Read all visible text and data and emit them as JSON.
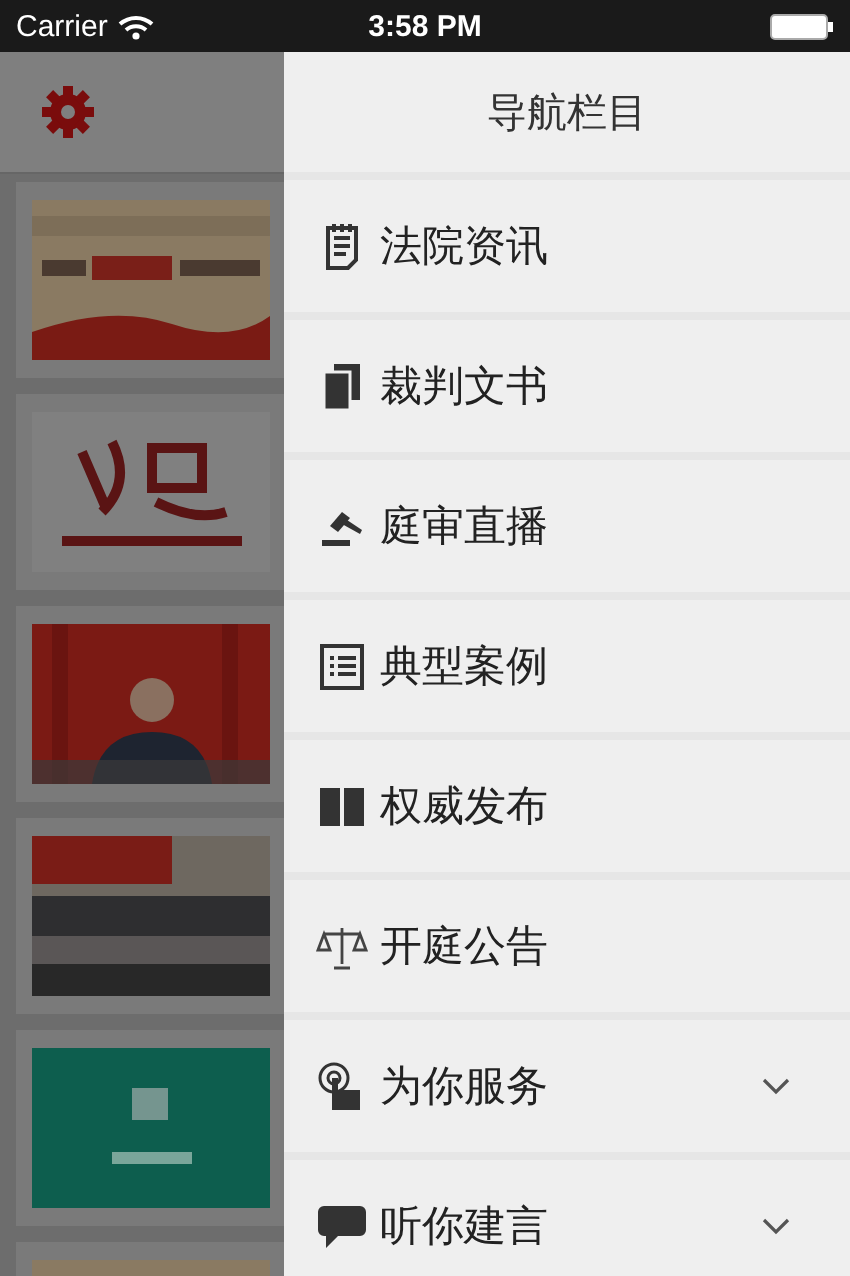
{
  "status_bar": {
    "carrier": "Carrier",
    "time": "3:58 PM"
  },
  "drawer": {
    "title": "导航栏目",
    "items": [
      {
        "label": "法院资讯",
        "kind": "link"
      },
      {
        "label": "裁判文书",
        "kind": "link"
      },
      {
        "label": "庭审直播",
        "kind": "link"
      },
      {
        "label": "典型案例",
        "kind": "link"
      },
      {
        "label": "权威发布",
        "kind": "link"
      },
      {
        "label": "开庭公告",
        "kind": "link"
      },
      {
        "label": "为你服务",
        "kind": "group",
        "expanded": false
      },
      {
        "label": "听你建言",
        "kind": "group",
        "expanded": false
      }
    ]
  }
}
